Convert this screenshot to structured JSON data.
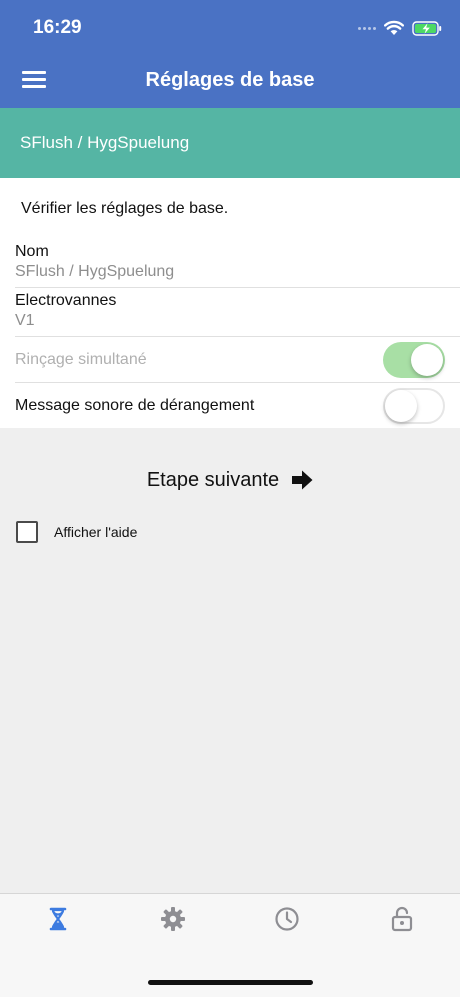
{
  "status_bar": {
    "time": "16:29"
  },
  "header": {
    "title": "Réglages de base"
  },
  "subheader": {
    "text": "SFlush / HygSpuelung"
  },
  "card": {
    "intro": "Vérifier les réglages de base.",
    "fields": [
      {
        "label": "Nom",
        "value": "SFlush / HygSpuelung"
      },
      {
        "label": "Electrovannes",
        "value": "V1"
      }
    ],
    "toggles": [
      {
        "label": "Rinçage simultané",
        "state": "on",
        "disabled": true
      },
      {
        "label": "Message sonore de dérangement",
        "state": "off",
        "disabled": false
      }
    ]
  },
  "next_step": {
    "label": "Etape suivante",
    "icon": "arrow-right-icon"
  },
  "help": {
    "label": "Afficher l'aide",
    "checked": false
  },
  "tabbar": {
    "tabs": [
      {
        "icon": "hourglass-icon",
        "active": true
      },
      {
        "icon": "gear-icon",
        "active": false
      },
      {
        "icon": "clock-icon",
        "active": false
      },
      {
        "icon": "unlocked-padlock-icon",
        "active": false
      }
    ]
  },
  "colors": {
    "header": "#4a72c4",
    "subheader": "#55b5a4",
    "toggle_on": "#a8dfa5",
    "tab_active": "#3d7be0",
    "tab_inactive": "#8e8e93"
  }
}
